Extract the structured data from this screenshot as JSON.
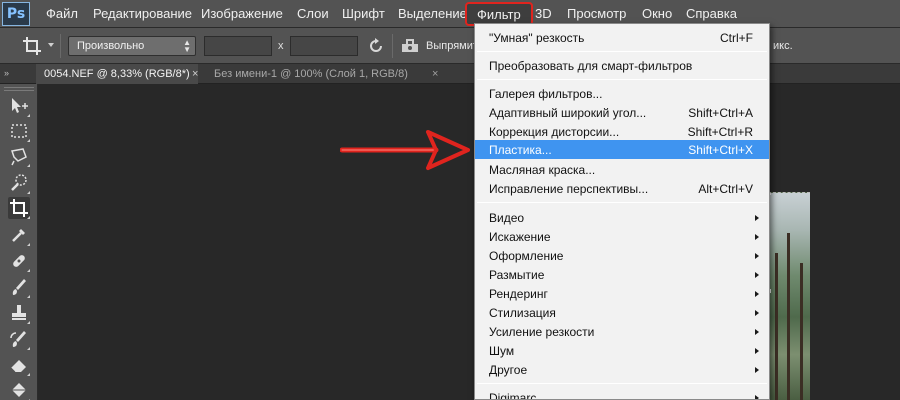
{
  "menubar": {
    "logo": "Ps",
    "items": [
      "Файл",
      "Редактирование",
      "Изображение",
      "Слои",
      "Шрифт",
      "Выделение",
      "Фильтр",
      "3D",
      "Просмотр",
      "Окно",
      "Справка"
    ],
    "active_item": "Фильтр"
  },
  "options": {
    "ratio_preset": "Произвольно",
    "x_label": "x",
    "straighten_label": "Выпрямить",
    "right_label": "икс."
  },
  "tabs": [
    {
      "label": "0054.NEF @ 8,33% (RGB/8*)",
      "close": "×"
    },
    {
      "label": "Без имени-1 @ 100% (Слой 1, RGB/8)",
      "close": "×"
    }
  ],
  "tabs_collapse": "»",
  "filter_menu": {
    "items": [
      {
        "label": "\"Умная\" резкость",
        "shortcut": "Ctrl+F"
      },
      {
        "label": "Преобразовать для смарт-фильтров",
        "shortcut": ""
      },
      {
        "label": "Галерея фильтров...",
        "shortcut": ""
      },
      {
        "label": "Адаптивный широкий угол...",
        "shortcut": "Shift+Ctrl+A"
      },
      {
        "label": "Коррекция дисторсии...",
        "shortcut": "Shift+Ctrl+R"
      },
      {
        "label": "Пластика...",
        "shortcut": "Shift+Ctrl+X"
      },
      {
        "label": "Масляная краска...",
        "shortcut": ""
      },
      {
        "label": "Исправление перспективы...",
        "shortcut": "Alt+Ctrl+V"
      },
      {
        "label": "Видео",
        "shortcut": ""
      },
      {
        "label": "Искажение",
        "shortcut": ""
      },
      {
        "label": "Оформление",
        "shortcut": ""
      },
      {
        "label": "Размытие",
        "shortcut": ""
      },
      {
        "label": "Рендеринг",
        "shortcut": ""
      },
      {
        "label": "Стилизация",
        "shortcut": ""
      },
      {
        "label": "Усиление резкости",
        "shortcut": ""
      },
      {
        "label": "Шум",
        "shortcut": ""
      },
      {
        "label": "Другое",
        "shortcut": ""
      },
      {
        "label": "Digimarc",
        "shortcut": ""
      }
    ],
    "highlighted": "Пластика..."
  },
  "colors": {
    "highlight": "#3f94f0",
    "annotation_red": "#e0241e",
    "ui_panel": "#535353",
    "workspace": "#282828"
  },
  "icons": {
    "toolbar": [
      "move-icon",
      "rect-marquee-icon",
      "lasso-icon",
      "quick-select-icon",
      "crop-icon",
      "eyedropper-icon",
      "healing-brush-icon",
      "brush-icon",
      "clone-stamp-icon",
      "history-brush-icon",
      "eraser-icon",
      "paint-bucket-icon"
    ]
  }
}
